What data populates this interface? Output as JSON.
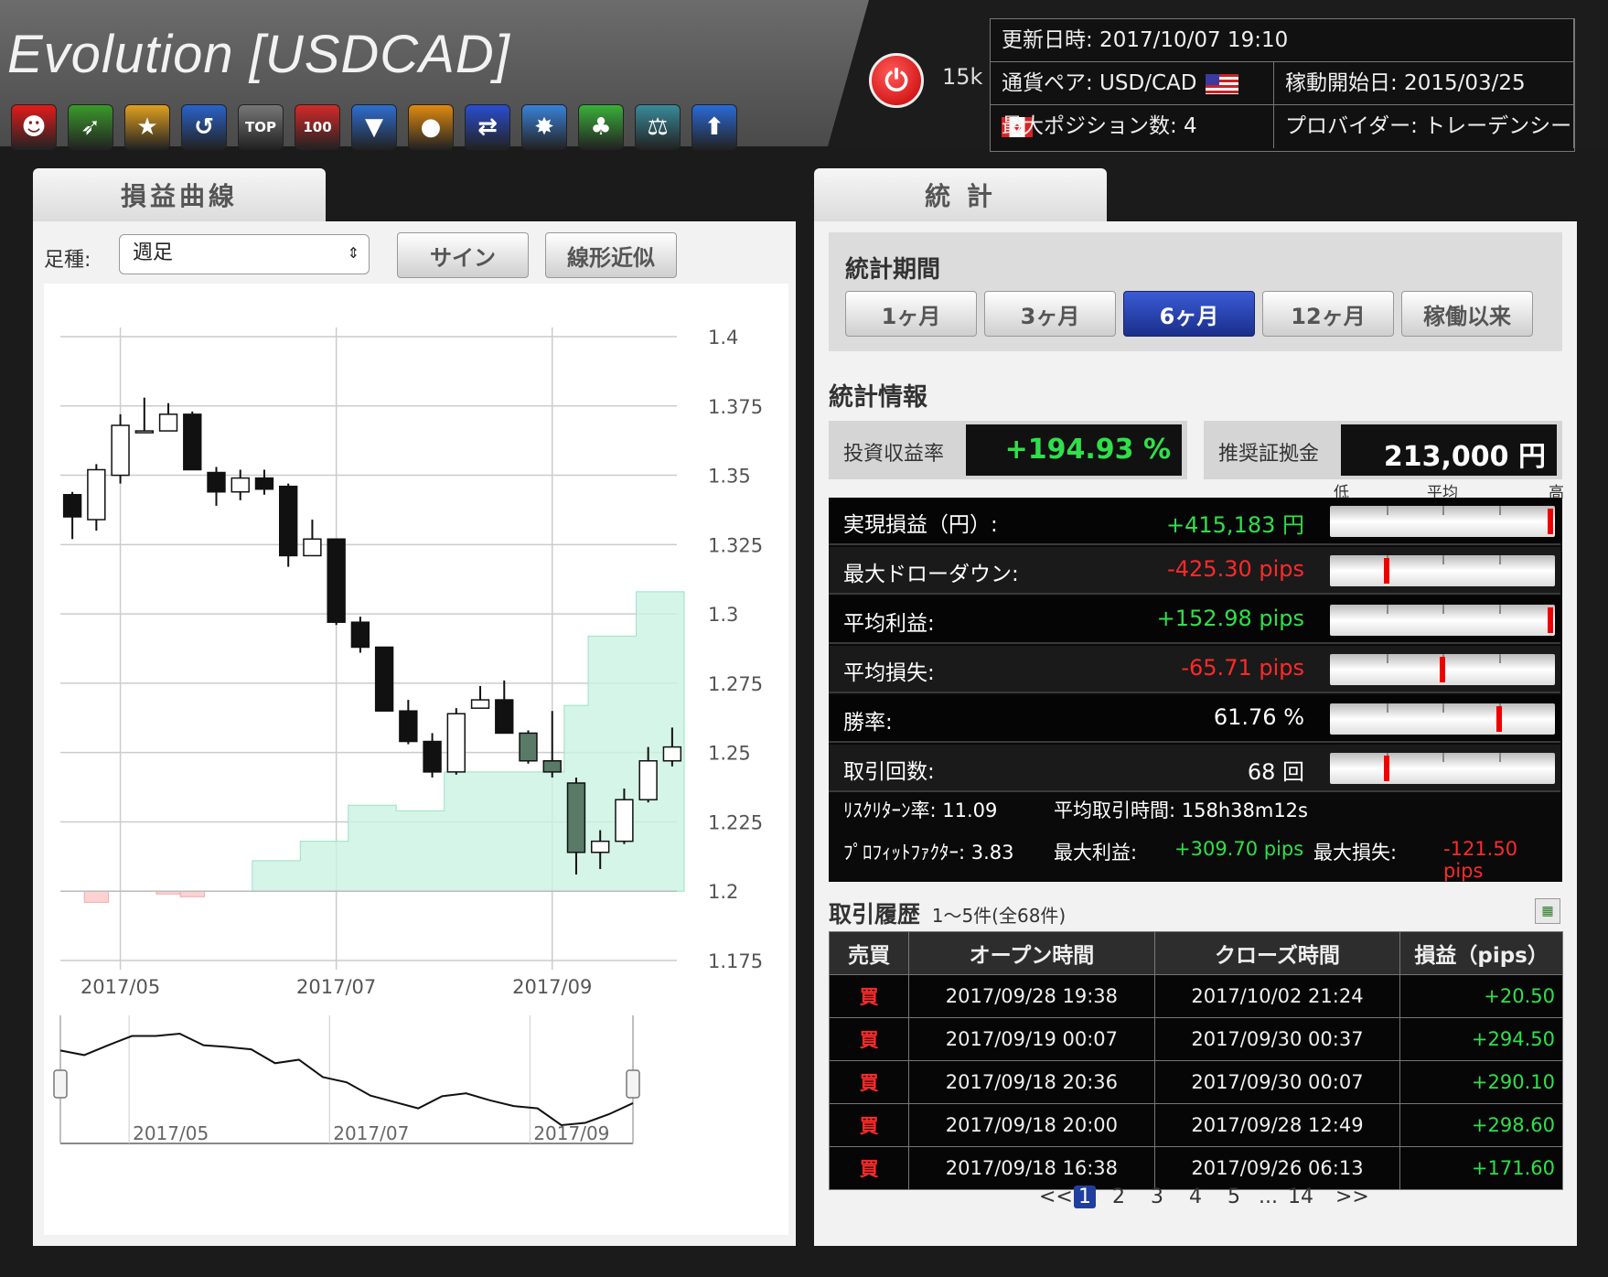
{
  "header": {
    "title": "Evolution [USDCAD]",
    "followers": "15k",
    "updated": "更新日時: 2017/10/07 19:10",
    "pair": "通貨ペア: USD/CAD",
    "start_date": "稼動開始日: 2015/03/25",
    "max_positions": "最大ポジション数: 4",
    "provider": "プロバイダー: トレーデンシー",
    "icons": [
      {
        "name": "smile-icon",
        "glyph": "☻",
        "color": "#e21b1b"
      },
      {
        "name": "target-icon",
        "glyph": "➶",
        "color": "#3a9a2a"
      },
      {
        "name": "star-medal-icon",
        "glyph": "★",
        "color": "#e0a020"
      },
      {
        "name": "upturn-arrow-icon",
        "glyph": "↺",
        "color": "#2a63c9"
      },
      {
        "name": "top100-icon",
        "glyph": "TOP",
        "color": "#777777"
      },
      {
        "name": "100-badge-icon",
        "glyph": "100",
        "color": "#d42a2a"
      },
      {
        "name": "beginner-leaf-icon",
        "glyph": "▼",
        "color": "#2f6fd0"
      },
      {
        "name": "egg-icon",
        "glyph": "●",
        "color": "#e08a10"
      },
      {
        "name": "shuffle-icon",
        "glyph": "⇄",
        "color": "#2a4ed0"
      },
      {
        "name": "burst-icon",
        "glyph": "✸",
        "color": "#3a82d8"
      },
      {
        "name": "tree-icon",
        "glyph": "♣",
        "color": "#3ab03a"
      },
      {
        "name": "scale-icon",
        "glyph": "⚖",
        "color": "#3a8a9a"
      },
      {
        "name": "up-arrow-icon",
        "glyph": "⬆",
        "color": "#2a6ad8"
      }
    ]
  },
  "left": {
    "tab": "損益曲線",
    "period_label": "足種:",
    "period_value": "週足",
    "sign_btn": "サイン",
    "linear_btn": "線形近似"
  },
  "right": {
    "tab": "統 計",
    "period_title": "統計期間",
    "periods": [
      "1ヶ月",
      "3ヶ月",
      "6ヶ月",
      "12ヶ月",
      "稼働以来"
    ],
    "info_title": "統計情報",
    "roi_label": "投資収益率",
    "roi_value": "+194.93 %",
    "margin_label": "推奨証拠金",
    "margin_value": "213,000 円",
    "gauge_low": "低",
    "gauge_avg": "平均",
    "gauge_high": "高",
    "stats": [
      {
        "label": "実現損益（円）:",
        "value": "+415,183 円",
        "cls": "green",
        "level": 0.98
      },
      {
        "label": "最大ドローダウン:",
        "value": "-425.30 pips",
        "cls": "red",
        "level": 0.25
      },
      {
        "label": "平均利益:",
        "value": "+152.98 pips",
        "cls": "green",
        "level": 0.98
      },
      {
        "label": "平均損失:",
        "value": "-65.71 pips",
        "cls": "red",
        "level": 0.5
      },
      {
        "label": "勝率:",
        "value": "61.76 %",
        "cls": "white",
        "level": 0.75
      },
      {
        "label": "取引回数:",
        "value": "68 回",
        "cls": "white",
        "level": 0.25
      }
    ],
    "risk_return": "ﾘｽｸﾘﾀｰﾝ率: 11.09",
    "avg_time": "平均取引時間: 158h38m12s",
    "profit_factor": "ﾌﾟﾛﾌｨｯﾄﾌｧｸﾀｰ: 3.83",
    "max_profit_label": "最大利益:",
    "max_profit_value": "+309.70 pips",
    "max_loss_label": "最大損失:",
    "max_loss_value": "-121.50 pips",
    "history_title": "取引履歴",
    "history_count": "1〜5件(全68件)",
    "trade_headers": [
      "売買",
      "オープン時間",
      "クローズ時間",
      "損益（pips）"
    ],
    "trades": [
      [
        "買",
        "2017/09/28 19:38",
        "2017/10/02 21:24",
        "+20.50"
      ],
      [
        "買",
        "2017/09/19 00:07",
        "2017/09/30 00:37",
        "+294.50"
      ],
      [
        "買",
        "2017/09/18 20:36",
        "2017/09/30 00:07",
        "+290.10"
      ],
      [
        "買",
        "2017/09/18 20:00",
        "2017/09/28 12:49",
        "+298.60"
      ],
      [
        "買",
        "2017/09/18 16:38",
        "2017/09/26 06:13",
        "+171.60"
      ]
    ],
    "pager": {
      "prev": "<<",
      "pages": [
        "1",
        "2",
        "3",
        "4",
        "5"
      ],
      "ellipsis": "...",
      "last": "14",
      "next": ">>"
    }
  },
  "chart_data": {
    "type": "candlestick",
    "y_ticks": [
      "1.4",
      "1.375",
      "1.35",
      "1.325",
      "1.3",
      "1.275",
      "1.25",
      "1.225",
      "1.2",
      "1.175"
    ],
    "ylim": [
      1.175,
      1.4
    ],
    "x_labels": [
      "2017/05",
      "2017/07",
      "2017/09"
    ],
    "candles": [
      {
        "o": 1.343,
        "c": 1.335,
        "h": 1.344,
        "l": 1.327
      },
      {
        "o": 1.334,
        "c": 1.352,
        "h": 1.354,
        "l": 1.33
      },
      {
        "o": 1.35,
        "c": 1.368,
        "h": 1.372,
        "l": 1.347
      },
      {
        "o": 1.366,
        "c": 1.366,
        "h": 1.378,
        "l": 1.366
      },
      {
        "o": 1.366,
        "c": 1.372,
        "h": 1.376,
        "l": 1.366
      },
      {
        "o": 1.372,
        "c": 1.352,
        "h": 1.373,
        "l": 1.352
      },
      {
        "o": 1.351,
        "c": 1.344,
        "h": 1.353,
        "l": 1.339
      },
      {
        "o": 1.344,
        "c": 1.349,
        "h": 1.352,
        "l": 1.341
      },
      {
        "o": 1.349,
        "c": 1.345,
        "h": 1.352,
        "l": 1.343
      },
      {
        "o": 1.346,
        "c": 1.321,
        "h": 1.347,
        "l": 1.317
      },
      {
        "o": 1.321,
        "c": 1.327,
        "h": 1.334,
        "l": 1.321
      },
      {
        "o": 1.327,
        "c": 1.297,
        "h": 1.327,
        "l": 1.296
      },
      {
        "o": 1.297,
        "c": 1.288,
        "h": 1.299,
        "l": 1.286
      },
      {
        "o": 1.288,
        "c": 1.265,
        "h": 1.288,
        "l": 1.265
      },
      {
        "o": 1.265,
        "c": 1.254,
        "h": 1.269,
        "l": 1.253
      },
      {
        "o": 1.254,
        "c": 1.243,
        "h": 1.257,
        "l": 1.241
      },
      {
        "o": 1.243,
        "c": 1.264,
        "h": 1.266,
        "l": 1.242
      },
      {
        "o": 1.266,
        "c": 1.269,
        "h": 1.274,
        "l": 1.266
      },
      {
        "o": 1.269,
        "c": 1.257,
        "h": 1.276,
        "l": 1.257
      },
      {
        "o": 1.257,
        "c": 1.247,
        "h": 1.258,
        "l": 1.246
      },
      {
        "o": 1.247,
        "c": 1.243,
        "h": 1.265,
        "l": 1.241
      },
      {
        "o": 1.239,
        "c": 1.214,
        "h": 1.241,
        "l": 1.206
      },
      {
        "o": 1.214,
        "c": 1.218,
        "h": 1.222,
        "l": 1.208
      },
      {
        "o": 1.218,
        "c": 1.233,
        "h": 1.237,
        "l": 1.217
      },
      {
        "o": 1.233,
        "c": 1.247,
        "h": 1.252,
        "l": 1.232
      },
      {
        "o": 1.247,
        "c": 1.252,
        "h": 1.259,
        "l": 1.245
      }
    ],
    "equity": [
      1.2,
      1.2,
      1.2,
      1.2,
      1.2,
      1.2,
      1.2,
      1.2,
      1.211,
      1.211,
      1.218,
      1.218,
      1.231,
      1.231,
      1.229,
      1.229,
      1.243,
      1.243,
      1.243,
      1.243,
      1.243,
      1.267,
      1.292,
      1.292,
      1.308,
      1.308
    ],
    "navigator": {
      "x_labels": [
        "2017/05",
        "2017/07",
        "2017/09"
      ],
      "values": [
        1.343,
        1.335,
        1.352,
        1.368,
        1.368,
        1.372,
        1.352,
        1.349,
        1.345,
        1.321,
        1.327,
        1.297,
        1.288,
        1.265,
        1.254,
        1.243,
        1.264,
        1.269,
        1.257,
        1.247,
        1.243,
        1.214,
        1.218,
        1.233,
        1.252
      ]
    }
  }
}
